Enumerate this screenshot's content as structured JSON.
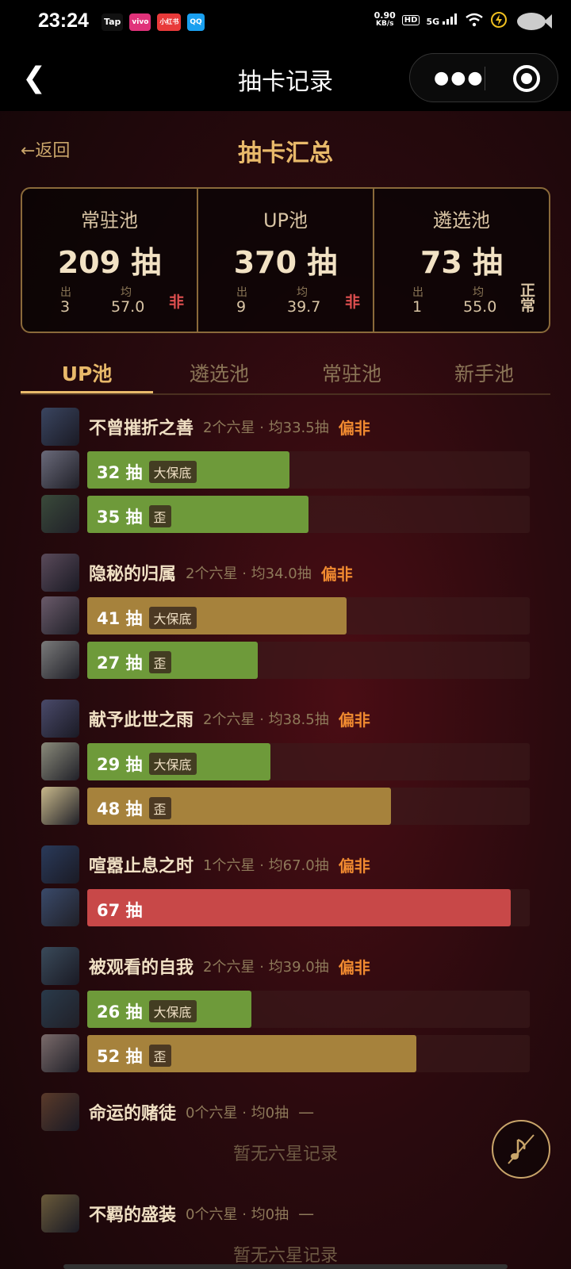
{
  "status": {
    "time": "23:24",
    "apps": [
      "Tap",
      "vivo",
      "小红书",
      "QQ"
    ],
    "speed_value": "0.90",
    "speed_unit": "KB/s",
    "hd": "HD",
    "network": "5G"
  },
  "nav": {
    "title": "抽卡记录"
  },
  "page": {
    "back_label": "←返回",
    "title": "抽卡汇总"
  },
  "summary": [
    {
      "name": "常驻池",
      "count": "209 抽",
      "out_label": "出",
      "out": "3",
      "avg_label": "均",
      "avg": "57.0",
      "verdict": "非"
    },
    {
      "name": "UP池",
      "count": "370 抽",
      "out_label": "出",
      "out": "9",
      "avg_label": "均",
      "avg": "39.7",
      "verdict": "非"
    },
    {
      "name": "遴选池",
      "count": "73 抽",
      "out_label": "出",
      "out": "1",
      "avg_label": "均",
      "avg": "55.0",
      "verdict": "正常"
    }
  ],
  "tabs": [
    "UP池",
    "遴选池",
    "常驻池",
    "新手池"
  ],
  "groups": [
    {
      "name": "不曾摧折之善",
      "meta": "2个六星 · 均33.5抽",
      "verdict": "偏非",
      "bars": [
        {
          "text": "32 抽",
          "tag": "大保底",
          "pulls": 32,
          "color": "green"
        },
        {
          "text": "35 抽",
          "tag": "歪",
          "pulls": 35,
          "color": "green"
        }
      ]
    },
    {
      "name": "隐秘的归属",
      "meta": "2个六星 · 均34.0抽",
      "verdict": "偏非",
      "bars": [
        {
          "text": "41 抽",
          "tag": "大保底",
          "pulls": 41,
          "color": "gold"
        },
        {
          "text": "27 抽",
          "tag": "歪",
          "pulls": 27,
          "color": "green"
        }
      ]
    },
    {
      "name": "献予此世之雨",
      "meta": "2个六星 · 均38.5抽",
      "verdict": "偏非",
      "bars": [
        {
          "text": "29 抽",
          "tag": "大保底",
          "pulls": 29,
          "color": "green"
        },
        {
          "text": "48 抽",
          "tag": "歪",
          "pulls": 48,
          "color": "gold"
        }
      ]
    },
    {
      "name": "喧嚣止息之时",
      "meta": "1个六星 · 均67.0抽",
      "verdict": "偏非",
      "bars": [
        {
          "text": "67 抽",
          "tag": "",
          "pulls": 67,
          "color": "red"
        }
      ]
    },
    {
      "name": "被观看的自我",
      "meta": "2个六星 · 均39.0抽",
      "verdict": "偏非",
      "bars": [
        {
          "text": "26 抽",
          "tag": "大保底",
          "pulls": 26,
          "color": "green"
        },
        {
          "text": "52 抽",
          "tag": "歪",
          "pulls": 52,
          "color": "gold"
        }
      ]
    },
    {
      "name": "命运的赌徒",
      "meta": "0个六星 · 均0抽",
      "verdict": "—",
      "empty": "暂无六星记录",
      "bars": []
    },
    {
      "name": "不羁的盛装",
      "meta": "0个六星 · 均0抽",
      "verdict": "—",
      "empty": "暂无六星记录",
      "bars": []
    }
  ],
  "bar_max_pulls": 70,
  "colors": {
    "accent": "#e8b96a",
    "green": "#6e9a3a",
    "gold": "#a6823c",
    "red": "#c84848",
    "warn": "#f08a30"
  }
}
